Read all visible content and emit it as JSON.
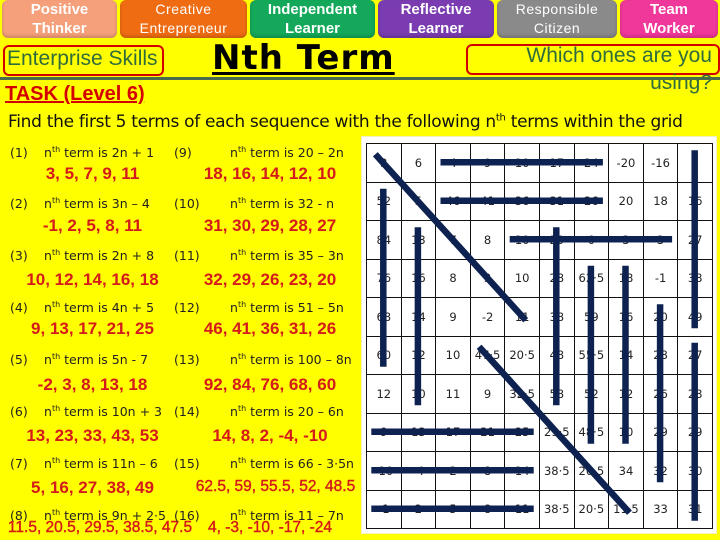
{
  "skills": [
    {
      "line1": "Positive",
      "line2": "Thinker",
      "color": "#f5a07a"
    },
    {
      "line1": "Creative",
      "line2": "Entrepreneur",
      "color": "#ef6c12"
    },
    {
      "line1": "Independent",
      "line2": "Learner",
      "color": "#13a85a"
    },
    {
      "line1": "Reflective",
      "line2": "Learner",
      "color": "#7a3cb0"
    },
    {
      "line1": "Responsible",
      "line2": "Citizen",
      "color": "#8a8a8a"
    },
    {
      "line1": "Team",
      "line2": "Worker",
      "color": "#f0379a"
    }
  ],
  "header": {
    "enterprise_skills": "Enterprise Skills",
    "title": "Nth Term",
    "which_ones": "Which ones are you using?",
    "task": "TASK (Level 6)"
  },
  "instruction": {
    "before": "Find the first 5 terms of each sequence with the following n",
    "sup": "th",
    "after": " terms within the grid"
  },
  "questions": [
    {
      "num": "(1)",
      "formula": "term is 2n + 1",
      "answer": "3, 5, 7, 9, 11"
    },
    {
      "num": "(2)",
      "formula": "term is 3n – 4",
      "answer": "-1, 2, 5, 8, 11"
    },
    {
      "num": "(3)",
      "formula": "term is 2n + 8",
      "answer": "10, 12, 14, 16, 18"
    },
    {
      "num": "(4)",
      "formula": "term is 4n + 5",
      "answer": "9, 13, 17, 21, 25"
    },
    {
      "num": "(5)",
      "formula": "term is 5n - 7",
      "answer": "-2, 3, 8, 13, 18"
    },
    {
      "num": "(6)",
      "formula": "term is 10n + 3",
      "answer": "13, 23, 33, 43, 53"
    },
    {
      "num": "(7)",
      "formula": "term is 11n – 6",
      "answer": "5, 16, 27, 38, 49"
    },
    {
      "num": "(8)",
      "formula": "term is 9n + 2·5",
      "answer": "11.5, 20.5, 29.5, 38.5, 47.5"
    },
    {
      "num": "(9)",
      "formula": "term is 20 – 2n",
      "answer": "18, 16, 14, 12, 10"
    },
    {
      "num": "(10)",
      "formula": "term is 32 - n",
      "answer": "31, 30, 29, 28, 27"
    },
    {
      "num": "(11)",
      "formula": "term is 35 – 3n",
      "answer": "32, 29, 26, 23, 20"
    },
    {
      "num": "(12)",
      "formula": "term is 51 – 5n",
      "answer": "46, 41, 36, 31, 26"
    },
    {
      "num": "(13)",
      "formula": "term is 100 – 8n",
      "answer": "92, 84, 76, 68, 60"
    },
    {
      "num": "(14)",
      "formula": "term is 20 – 6n",
      "answer": "14, 8, 2, -4, -10"
    },
    {
      "num": "(15)",
      "formula": "term is 66 - 3·5n",
      "answer": "62.5, 59, 55.5, 52, 48.5"
    },
    {
      "num": "(16)",
      "formula": "term is 11 – 7n",
      "answer": "4, -3, -10, -17, -24"
    }
  ],
  "nth": "n",
  "nth_sup": "th",
  "grid": [
    [
      "3",
      "6",
      "4",
      "9",
      "10",
      "17",
      "24",
      "-20",
      "-16",
      "5"
    ],
    [
      "52",
      "5",
      "46",
      "41",
      "36",
      "31",
      "26",
      "20",
      "18",
      "16"
    ],
    [
      "84",
      "13",
      "7",
      "8",
      "10",
      "20",
      "0",
      "3",
      "3",
      "27"
    ],
    [
      "76",
      "16",
      "8",
      "3",
      "10",
      "28",
      "62·5",
      "18",
      "-1",
      "38"
    ],
    [
      "68",
      "14",
      "9",
      "-2",
      "11",
      "38",
      "59",
      "16",
      "20",
      "49"
    ],
    [
      "60",
      "12",
      "10",
      "47·5",
      "20·5",
      "48",
      "55·5",
      "14",
      "28",
      "27"
    ],
    [
      "12",
      "10",
      "11",
      "9",
      "32·5",
      "58",
      "52",
      "12",
      "26",
      "28"
    ],
    [
      "9",
      "13",
      "17",
      "21",
      "25",
      "29·5",
      "48·5",
      "10",
      "29",
      "29"
    ],
    [
      "-10",
      "-4",
      "2",
      "8",
      "14",
      "38·5",
      "20·5",
      "34",
      "32",
      "30"
    ],
    [
      "-1",
      "2",
      "5",
      "8",
      "11",
      "38·5",
      "20·5",
      "11·5",
      "33",
      "31"
    ]
  ],
  "highlight_color": "#0d2250"
}
